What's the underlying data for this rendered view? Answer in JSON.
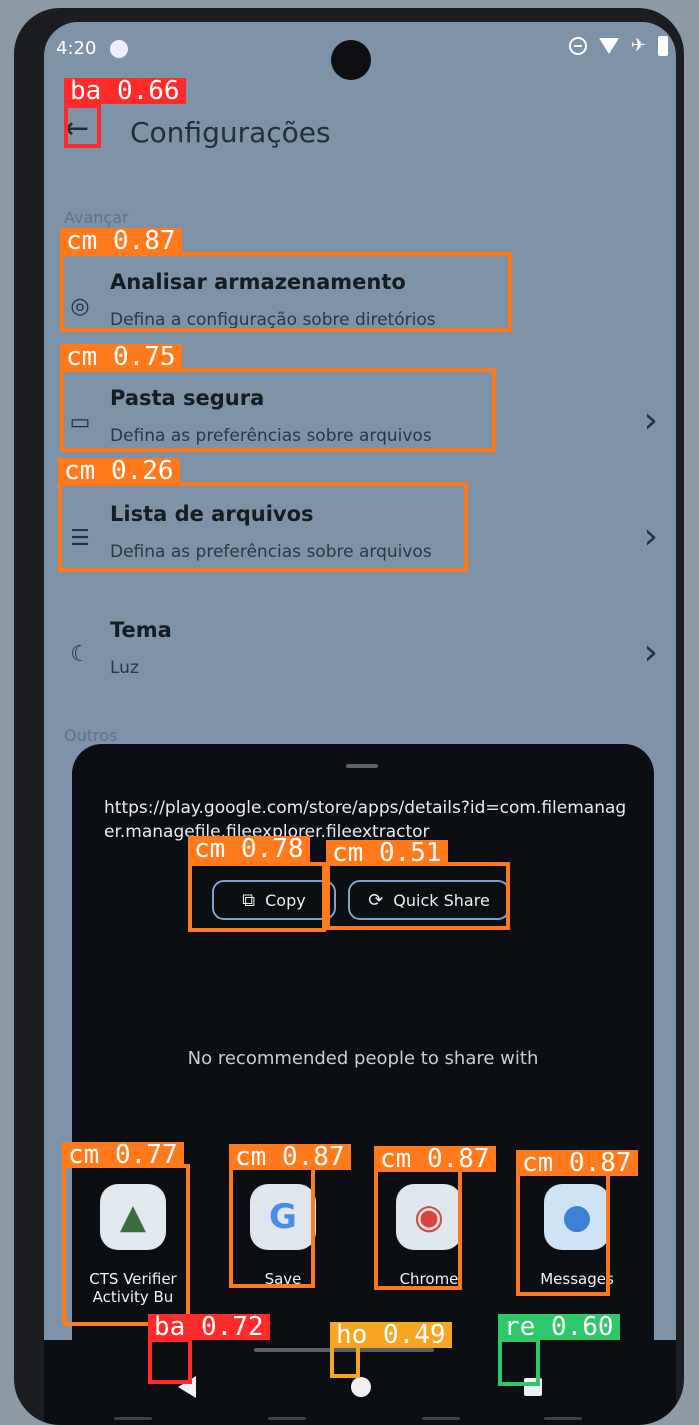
{
  "status": {
    "time": "4:20"
  },
  "header": {
    "back_icon": "arrow-left-icon",
    "title": "Configurações"
  },
  "sections": {
    "advanced": "Avançar",
    "others": "Outros"
  },
  "settings": [
    {
      "title": "Analisar armazenamento",
      "subtitle": "Defina a configuração sobre diretórios",
      "icon": "storage-scan-icon"
    },
    {
      "title": "Pasta segura",
      "subtitle": "Defina as preferências sobre arquivos",
      "icon": "secure-folder-icon"
    },
    {
      "title": "Lista de arquivos",
      "subtitle": "Defina as preferências sobre arquivos",
      "icon": "file-list-icon"
    },
    {
      "title": "Tema",
      "subtitle": "Luz",
      "icon": "moon-icon"
    }
  ],
  "share_sheet": {
    "url": "https://play.google.com/store/apps/details?id=com.filemanager.managefile.fileexplorer.fileextractor",
    "copy_label": "Copy",
    "quick_share_label": "Quick Share",
    "no_recommended": "No recommended people to share with",
    "apps": [
      {
        "label": "CTS Verifier",
        "label2": "Activity      Bu"
      },
      {
        "label": "Save"
      },
      {
        "label": "Chrome"
      },
      {
        "label": "Messages"
      }
    ]
  },
  "detections": [
    {
      "label": "ba 0.66",
      "color": "#ff2b2b"
    },
    {
      "label": "cm 0.87",
      "color": "#ff7a1c"
    },
    {
      "label": "cm 0.75",
      "color": "#ff7a1c"
    },
    {
      "label": "cm 0.26",
      "color": "#ff7a1c"
    },
    {
      "label": "cm 0.78",
      "color": "#ff7a1c"
    },
    {
      "label": "cm 0.51",
      "color": "#ff7a1c"
    },
    {
      "label": "cm 0.77",
      "color": "#ff7a1c"
    },
    {
      "label": "cm 0.87",
      "color": "#ff7a1c"
    },
    {
      "label": "cm 0.87",
      "color": "#ff7a1c"
    },
    {
      "label": "cm 0.87",
      "color": "#ff7a1c"
    },
    {
      "label": "ba 0.72",
      "color": "#ff2b2b"
    },
    {
      "label": "ho 0.49",
      "color": "#f6a623"
    },
    {
      "label": "re 0.60",
      "color": "#2ec86b"
    }
  ]
}
